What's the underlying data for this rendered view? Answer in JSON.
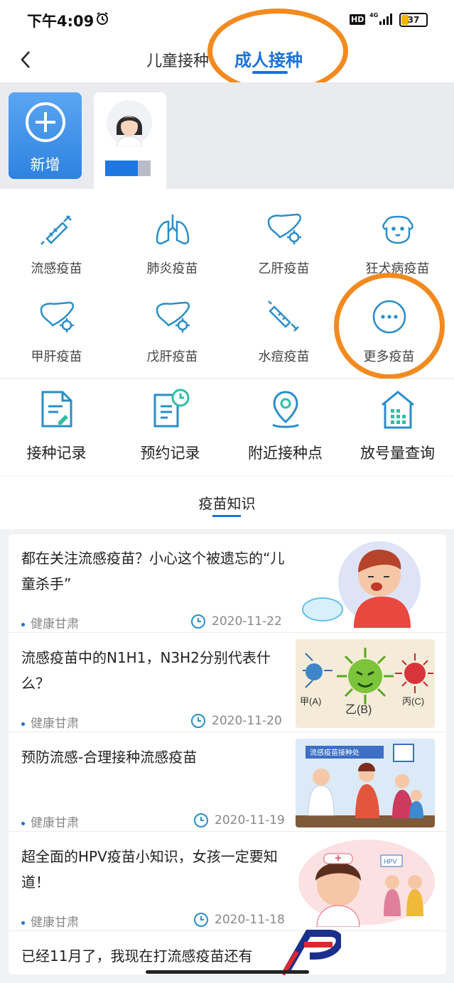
{
  "status_bar": {
    "time": "下午4:09",
    "hd": "HD",
    "network": "4G",
    "battery": "37"
  },
  "nav": {
    "tab_child": "儿童接种",
    "tab_adult": "成人接种"
  },
  "profiles": {
    "add_label": "新增"
  },
  "vaccines": [
    {
      "label": "流感疫苗",
      "icon": "syringe-icon"
    },
    {
      "label": "肺炎疫苗",
      "icon": "lungs-icon"
    },
    {
      "label": "乙肝疫苗",
      "icon": "liver-icon"
    },
    {
      "label": "狂犬病疫苗",
      "icon": "dog-icon"
    },
    {
      "label": "甲肝疫苗",
      "icon": "liver-icon"
    },
    {
      "label": "戊肝疫苗",
      "icon": "liver-icon"
    },
    {
      "label": "水痘疫苗",
      "icon": "syringe-icon"
    },
    {
      "label": "更多疫苗",
      "icon": "more-icon"
    }
  ],
  "records": [
    {
      "label": "接种记录",
      "icon": "document-icon"
    },
    {
      "label": "预约记录",
      "icon": "appointment-icon"
    },
    {
      "label": "附近接种点",
      "icon": "location-pin-icon"
    },
    {
      "label": "放号量查询",
      "icon": "building-icon"
    }
  ],
  "knowledge": {
    "title": "疫苗知识"
  },
  "articles": [
    {
      "title": "都在关注流感疫苗？小心这个被遗忘的“儿童杀手”",
      "source": "健康甘肃",
      "date": "2020-11-22"
    },
    {
      "title": "流感疫苗中的N1H1，N3H2分别代表什么？",
      "source": "健康甘肃",
      "date": "2020-11-20",
      "thumb_labels": [
        "甲(A)",
        "乙(B)",
        "丙(C)"
      ]
    },
    {
      "title": "预防流感-合理接种流感疫苗",
      "source": "健康甘肃",
      "date": "2020-11-19",
      "thumb_labels": [
        "流感疫苗接种处"
      ]
    },
    {
      "title": "超全面的HPV疫苗小知识，女孩一定要知道！",
      "source": "健康甘肃",
      "date": "2020-11-18",
      "thumb_labels": [
        "HPV"
      ]
    },
    {
      "title": "已经11月了，我现在打流感疫苗还有"
    }
  ],
  "colors": {
    "accent": "#1a73d9",
    "icon": "#2a8ec9",
    "annotation": "#f38a1f"
  }
}
